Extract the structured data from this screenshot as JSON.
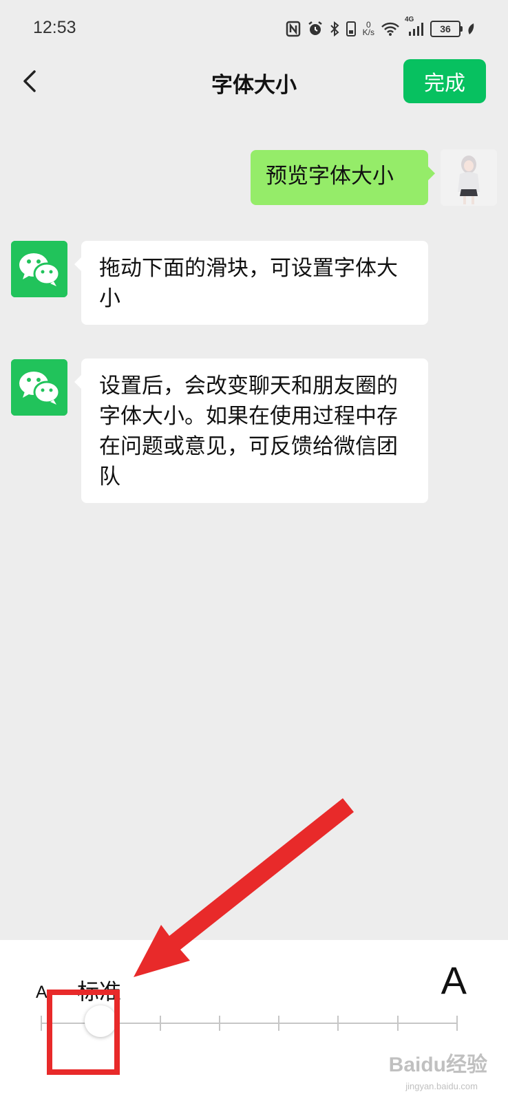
{
  "status_bar": {
    "time": "12:53",
    "net_speed_value": "0",
    "net_speed_unit": "K/s",
    "network_type": "4G",
    "battery_level": "36"
  },
  "header": {
    "title": "字体大小",
    "done_label": "完成"
  },
  "messages": [
    {
      "sender": "self",
      "text": "预览字体大小"
    },
    {
      "sender": "wechat",
      "text": "拖动下面的滑块，可设置字体大小"
    },
    {
      "sender": "wechat",
      "text": "设置后，会改变聊天和朋友圈的字体大小。如果在使用过程中存在问题或意见，可反馈给微信团队"
    }
  ],
  "font_size_panel": {
    "small_label": "A",
    "large_label": "A",
    "current_label": "标准",
    "levels": 8,
    "current_level": 2
  },
  "watermark": {
    "text": "Baidu经验",
    "subtext": "jingyan.baidu.com"
  },
  "colors": {
    "accent": "#07c160",
    "self_bubble": "#95ec69",
    "annotation": "#e82a2a"
  }
}
